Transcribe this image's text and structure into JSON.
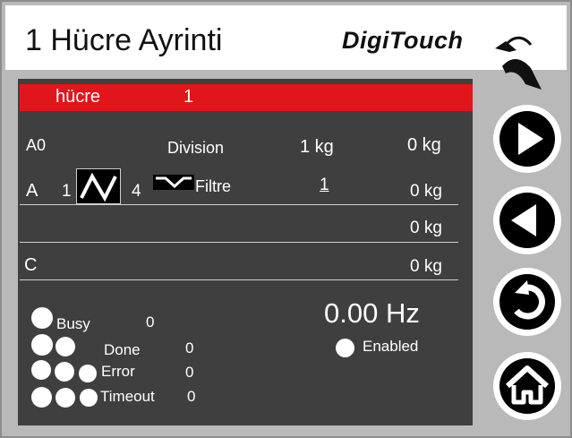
{
  "header": {
    "title": "1  Hücre Ayrinti",
    "logo_text": "DigiTouch"
  },
  "cell_bar": {
    "label": "hücre",
    "number": "1"
  },
  "row_a0": {
    "name": "A0",
    "division_label": "Division",
    "division_value": "1 kg",
    "weight": "0 kg"
  },
  "row_a": {
    "name": "A",
    "num1": "1",
    "num2": "4",
    "filter_label": "Filtre",
    "filter_value": "1",
    "weight": "0 kg"
  },
  "row_b": {
    "weight": "0 kg"
  },
  "row_c": {
    "name": "C",
    "weight": "0 kg"
  },
  "status": {
    "busy_label": "Busy",
    "busy_value": "0",
    "done_label": "Done",
    "done_value": "0",
    "error_label": "Error",
    "error_value": "0",
    "timeout_label": "Timeout",
    "timeout_value": "0"
  },
  "frequency": {
    "value": "0.00 Hz",
    "enabled_label": "Enabled"
  },
  "nav": {
    "icons": [
      "play-forward-icon",
      "play-back-icon",
      "undo-icon",
      "home-icon"
    ]
  },
  "colors": {
    "accent": "#e0161b",
    "panel": "#3f3f3f",
    "frame": "#b9b9b9"
  }
}
